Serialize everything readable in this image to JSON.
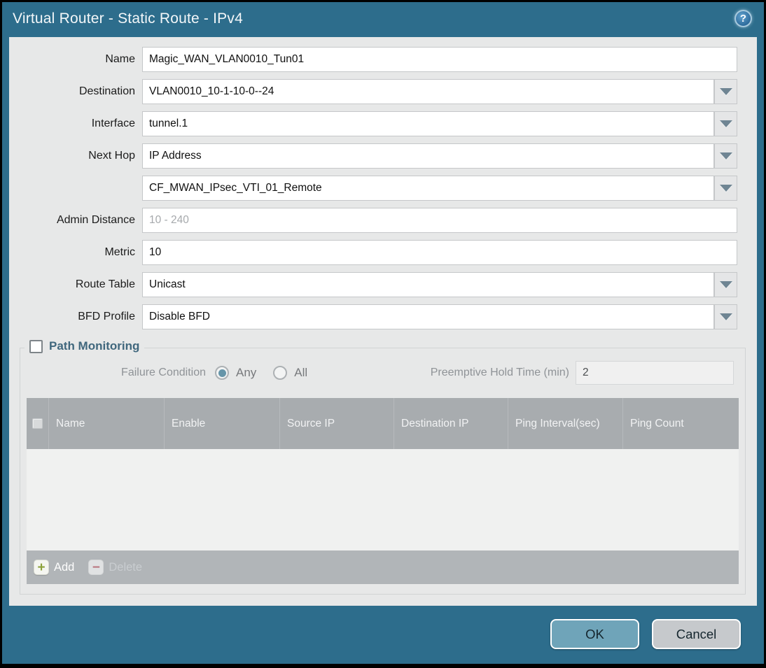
{
  "dialog": {
    "title": "Virtual Router - Static Route - IPv4",
    "help_glyph": "?"
  },
  "form": {
    "fields": [
      {
        "label": "Name",
        "value": "Magic_WAN_VLAN0010_Tun01",
        "type": "text"
      },
      {
        "label": "Destination",
        "value": "VLAN0010_10-1-10-0--24",
        "type": "dropdown"
      },
      {
        "label": "Interface",
        "value": "tunnel.1",
        "type": "dropdown"
      },
      {
        "label": "Next Hop",
        "value": "IP Address",
        "type": "dropdown"
      },
      {
        "label": "",
        "value": "CF_MWAN_IPsec_VTI_01_Remote",
        "type": "dropdown"
      },
      {
        "label": "Admin Distance",
        "value": "",
        "placeholder": "10 - 240",
        "type": "text"
      },
      {
        "label": "Metric",
        "value": "10",
        "type": "text"
      },
      {
        "label": "Route Table",
        "value": "Unicast",
        "type": "dropdown"
      },
      {
        "label": "BFD Profile",
        "value": "Disable BFD",
        "type": "dropdown"
      }
    ]
  },
  "path_monitoring": {
    "title": "Path Monitoring",
    "checked": false,
    "failure_condition_label": "Failure Condition",
    "failure_options": [
      {
        "label": "Any",
        "selected": true
      },
      {
        "label": "All",
        "selected": false
      }
    ],
    "preemptive_label": "Preemptive Hold Time (min)",
    "preemptive_value": "2",
    "table": {
      "columns": [
        "Name",
        "Enable",
        "Source IP",
        "Destination IP",
        "Ping Interval(sec)",
        "Ping Count"
      ],
      "rows": []
    },
    "add_label": "Add",
    "add_glyph": "+",
    "delete_label": "Delete",
    "delete_glyph": "−"
  },
  "footer": {
    "ok_label": "OK",
    "cancel_label": "Cancel"
  },
  "colors": {
    "frame_teal": "#2d6d8c",
    "content_bg": "#e7e8e8",
    "table_header_bg": "#a8acaf",
    "table_footer_bg": "#b1b5b8",
    "ok_button_bg": "#6fa4b9",
    "cancel_button_bg": "#c6c9cc",
    "radio_selected": "#6695a9",
    "add_plus_green": "#8ba13a",
    "delete_minus_red": "#b9767f",
    "pm_title_color": "#40677d"
  }
}
